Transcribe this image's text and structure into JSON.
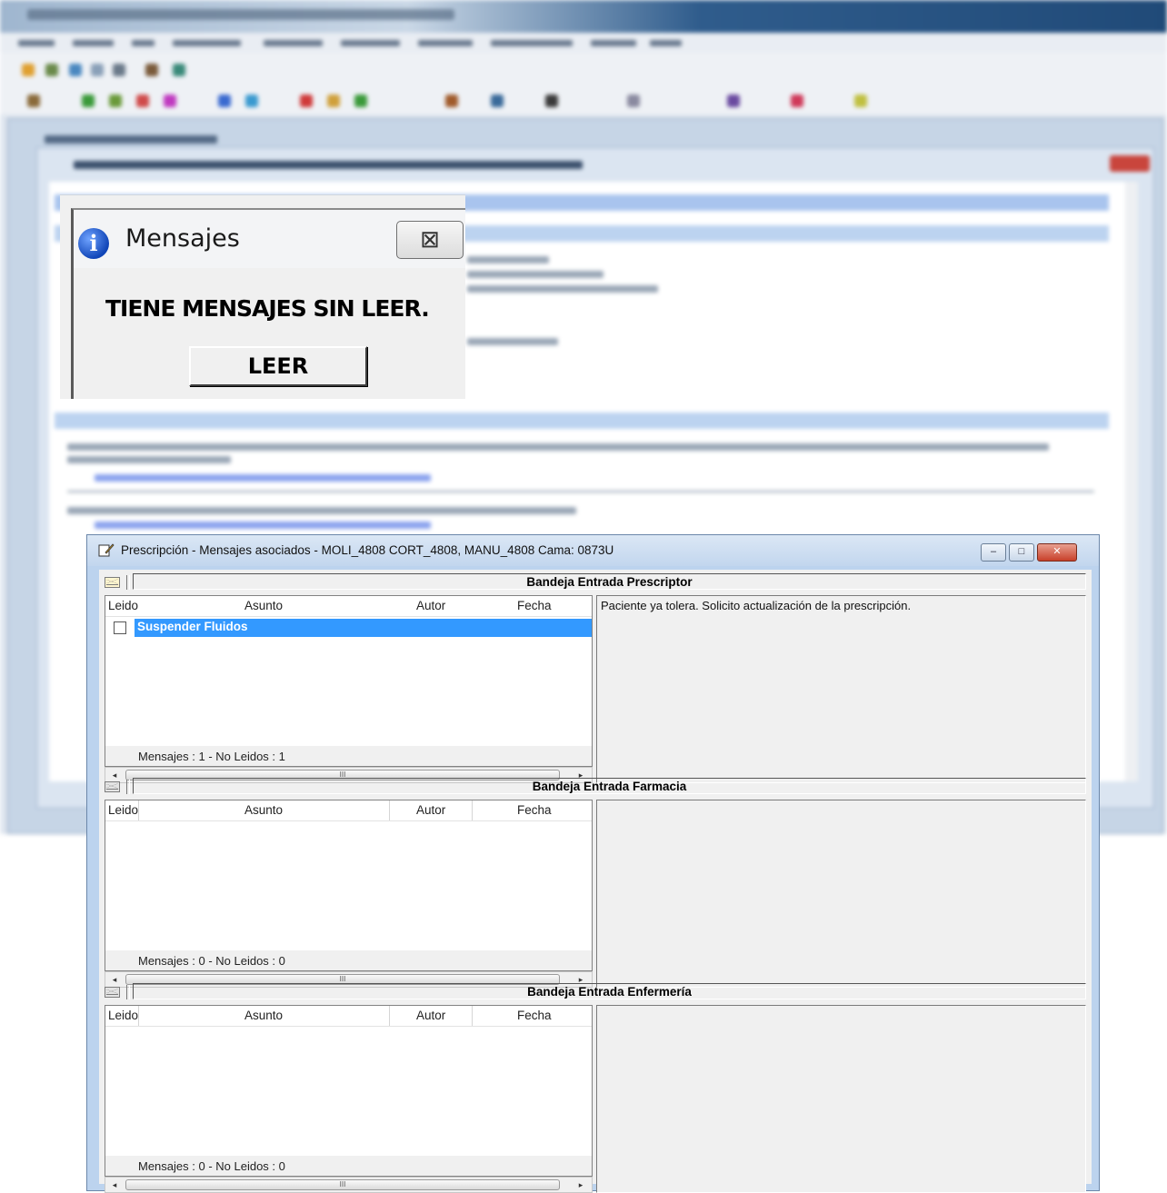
{
  "popup": {
    "title": "Mensajes",
    "close_glyph": "⊠",
    "message": "TIENE MENSAJES SIN LEER.",
    "button_label": "LEER",
    "icon": "info-icon"
  },
  "window": {
    "title": "Prescripción - Mensajes asociados - MOLI_4808 CORT_4808, MANU_4808 Cama: 0873U",
    "buttons": {
      "minimize": "–",
      "maximize": "□",
      "close": "✕"
    }
  },
  "columns": {
    "leido": "Leido",
    "asunto": "Asunto",
    "autor": "Autor",
    "fecha": "Fecha"
  },
  "scroll": {
    "left": "◂",
    "right": "▸",
    "thumb": "III"
  },
  "trays": [
    {
      "title": "Bandeja Entrada Prescriptor",
      "icon": "envelope-icon",
      "rows": [
        {
          "leido": false,
          "asunto": "Suspender Fluidos",
          "autor": "",
          "fecha": ""
        }
      ],
      "count": "Mensajes : 1 - No Leidos : 1",
      "detail": "Paciente ya tolera. Solicito actualización de la prescripción."
    },
    {
      "title": "Bandeja Entrada Farmacia",
      "icon": "envelope-icon",
      "rows": [],
      "count": "Mensajes : 0 - No Leidos : 0",
      "detail": ""
    },
    {
      "title": "Bandeja Entrada Enfermería",
      "icon": "envelope-icon",
      "rows": [],
      "count": "Mensajes : 0 - No Leidos : 0",
      "detail": ""
    }
  ],
  "colors": {
    "selection": "#3399ff",
    "window_frame": "#bcd3ee",
    "panel": "#f0f0f0"
  }
}
